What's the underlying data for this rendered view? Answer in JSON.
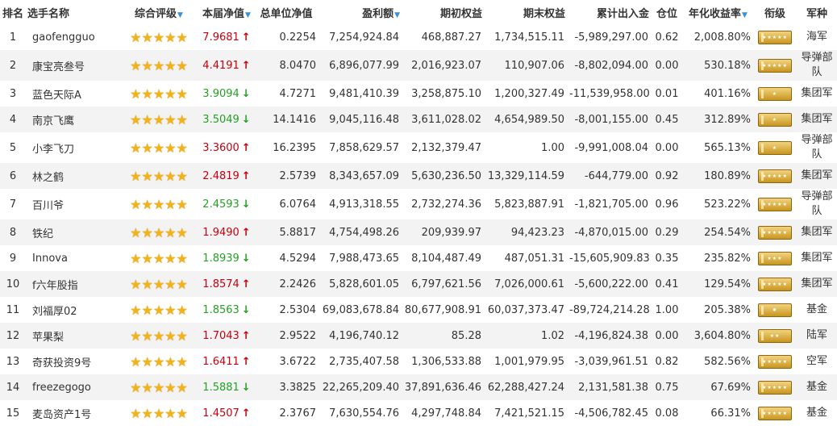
{
  "headers": {
    "rank": "排名",
    "name": "选手名称",
    "rating": "综合评级",
    "weekly_nav": "本届净值",
    "total_nav": "总单位净值",
    "profit": "盈利额",
    "initial_equity": "期初权益",
    "final_equity": "期末权益",
    "net_flow": "累计出入金",
    "position": "仓位",
    "annual_return": "年化收益率",
    "rank_title": "衔级",
    "branch": "军种"
  },
  "sortable_columns": [
    "rating",
    "weekly_nav",
    "total_nav",
    "profit",
    "annual_return"
  ],
  "colors": {
    "up": "#c8000f",
    "down": "#24a124",
    "star": "#f2b31a",
    "caret": "#3a8fd9"
  },
  "rows": [
    {
      "rank": "1",
      "name": "gaofengguo",
      "stars": 5,
      "weekly_nav": "7.9681",
      "dir": "up",
      "total_nav": "0.2254",
      "profit": "7,254,924.84",
      "initial": "468,887.27",
      "final": "1,734,515.11",
      "flow": "-5,989,297.00",
      "position": "0.62",
      "annual": "2,008.80%",
      "badge": "★★★★★",
      "branch": "海军"
    },
    {
      "rank": "2",
      "name": "康宝亮叁号",
      "stars": 5,
      "weekly_nav": "4.4191",
      "dir": "up",
      "total_nav": "8.0470",
      "profit": "6,896,077.99",
      "initial": "2,016,923.07",
      "final": "110,907.06",
      "flow": "-8,802,094.00",
      "position": "0.00",
      "annual": "530.18%",
      "badge": "★★★★★",
      "branch": "导弹部队"
    },
    {
      "rank": "3",
      "name": "蓝色天际A",
      "stars": 5,
      "weekly_nav": "3.9094",
      "dir": "down",
      "total_nav": "4.7271",
      "profit": "9,481,410.39",
      "initial": "3,258,875.10",
      "final": "1,200,327.49",
      "flow": "-11,539,958.00",
      "position": "0.01",
      "annual": "401.16%",
      "badge": "★",
      "branch": "集团军"
    },
    {
      "rank": "4",
      "name": "南京飞鹰",
      "stars": 5,
      "weekly_nav": "3.5049",
      "dir": "down",
      "total_nav": "14.1416",
      "profit": "9,045,116.48",
      "initial": "3,611,028.02",
      "final": "4,654,989.50",
      "flow": "-8,001,155.00",
      "position": "0.45",
      "annual": "312.89%",
      "badge": "★",
      "branch": "集团军"
    },
    {
      "rank": "5",
      "name": "小李飞刀",
      "stars": 5,
      "weekly_nav": "3.3600",
      "dir": "up",
      "total_nav": "16.2395",
      "profit": "7,858,629.57",
      "initial": "2,132,379.47",
      "final": "1.00",
      "flow": "-9,991,008.04",
      "position": "0.00",
      "annual": "565.13%",
      "badge": "★",
      "branch": "导弹部队"
    },
    {
      "rank": "6",
      "name": "林之鹤",
      "stars": 5,
      "weekly_nav": "2.4819",
      "dir": "up",
      "total_nav": "2.5739",
      "profit": "8,343,657.09",
      "initial": "5,630,236.50",
      "final": "13,329,114.59",
      "flow": "-644,779.00",
      "position": "0.92",
      "annual": "180.89%",
      "badge": "★★★★★",
      "branch": "集团军"
    },
    {
      "rank": "7",
      "name": "百川爷",
      "stars": 5,
      "weekly_nav": "2.4593",
      "dir": "down",
      "total_nav": "6.0764",
      "profit": "4,913,318.55",
      "initial": "2,732,274.36",
      "final": "5,823,887.91",
      "flow": "-1,821,705.00",
      "position": "0.96",
      "annual": "523.22%",
      "badge": "★★★★★",
      "branch": "导弹部队"
    },
    {
      "rank": "8",
      "name": "铁纪",
      "stars": 5,
      "weekly_nav": "1.9490",
      "dir": "up",
      "total_nav": "5.8817",
      "profit": "4,754,498.26",
      "initial": "209,939.97",
      "final": "94,423.23",
      "flow": "-4,870,015.00",
      "position": "0.29",
      "annual": "254.54%",
      "badge": "★★★★★",
      "branch": "集团军"
    },
    {
      "rank": "9",
      "name": "Innova",
      "stars": 5,
      "weekly_nav": "1.8939",
      "dir": "down",
      "total_nav": "4.5294",
      "profit": "7,988,473.65",
      "initial": "8,104,487.49",
      "final": "487,051.31",
      "flow": "-15,605,909.83",
      "position": "0.35",
      "annual": "235.82%",
      "badge": "★★★",
      "branch": "集团军"
    },
    {
      "rank": "10",
      "name": "f六年股指",
      "stars": 5,
      "weekly_nav": "1.8574",
      "dir": "up",
      "total_nav": "2.2426",
      "profit": "5,828,601.05",
      "initial": "6,797,621.56",
      "final": "7,026,000.61",
      "flow": "-5,600,222.00",
      "position": "0.41",
      "annual": "129.54%",
      "badge": "★★★★★",
      "branch": "集团军"
    },
    {
      "rank": "11",
      "name": "刘福厚02",
      "stars": 5,
      "weekly_nav": "1.8563",
      "dir": "down",
      "total_nav": "2.5304",
      "profit": "69,083,678.84",
      "initial": "80,677,908.91",
      "final": "60,037,373.47",
      "flow": "-89,724,214.28",
      "position": "1.00",
      "annual": "205.38%",
      "badge": "✸",
      "branch": "基金"
    },
    {
      "rank": "12",
      "name": "苹果梨",
      "stars": 5,
      "weekly_nav": "1.7043",
      "dir": "up",
      "total_nav": "2.9522",
      "profit": "4,196,740.12",
      "initial": "85.28",
      "final": "1.02",
      "flow": "-4,196,824.38",
      "position": "0.00",
      "annual": "3,604.80%",
      "badge": "★★",
      "branch": "陆军"
    },
    {
      "rank": "13",
      "name": "奇获投资9号",
      "stars": 5,
      "weekly_nav": "1.6411",
      "dir": "up",
      "total_nav": "3.6722",
      "profit": "2,735,407.58",
      "initial": "1,306,533.88",
      "final": "1,001,979.95",
      "flow": "-3,039,961.51",
      "position": "0.82",
      "annual": "582.56%",
      "badge": "★★★★★",
      "branch": "空军"
    },
    {
      "rank": "14",
      "name": "freezegogo",
      "stars": 5,
      "weekly_nav": "1.5881",
      "dir": "down",
      "total_nav": "3.3825",
      "profit": "22,265,209.40",
      "initial": "37,891,636.46",
      "final": "62,288,427.24",
      "flow": "2,131,581.38",
      "position": "0.75",
      "annual": "67.69%",
      "badge": "★★★★★",
      "branch": "基金"
    },
    {
      "rank": "15",
      "name": "麦岛资产1号",
      "stars": 5,
      "weekly_nav": "1.4507",
      "dir": "up",
      "total_nav": "2.3767",
      "profit": "7,630,554.76",
      "initial": "4,297,748.84",
      "final": "7,421,521.15",
      "flow": "-4,506,782.45",
      "position": "0.08",
      "annual": "66.31%",
      "badge": "★★★★★",
      "branch": "基金"
    }
  ]
}
